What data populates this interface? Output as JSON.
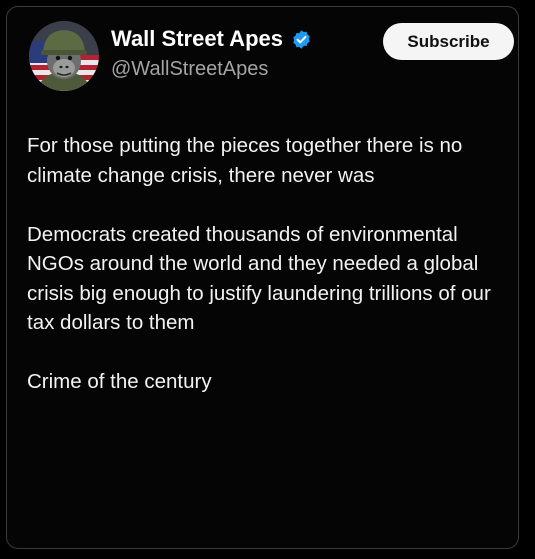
{
  "tweet": {
    "author": {
      "display_name": "Wall Street Apes",
      "handle": "@WallStreetApes",
      "avatar_icon": "gorilla-soldier-avatar",
      "verified_icon": "verified-badge-icon",
      "verified_color": "#1d9bf0"
    },
    "subscribe_label": "Subscribe",
    "paragraphs": [
      "For those putting the pieces together there is no climate change crisis, there never was",
      "Democrats created thousands of environmental NGOs around the world and they needed a global crisis big enough to justify laundering trillions of our tax dollars to them",
      "Crime of the century"
    ]
  }
}
